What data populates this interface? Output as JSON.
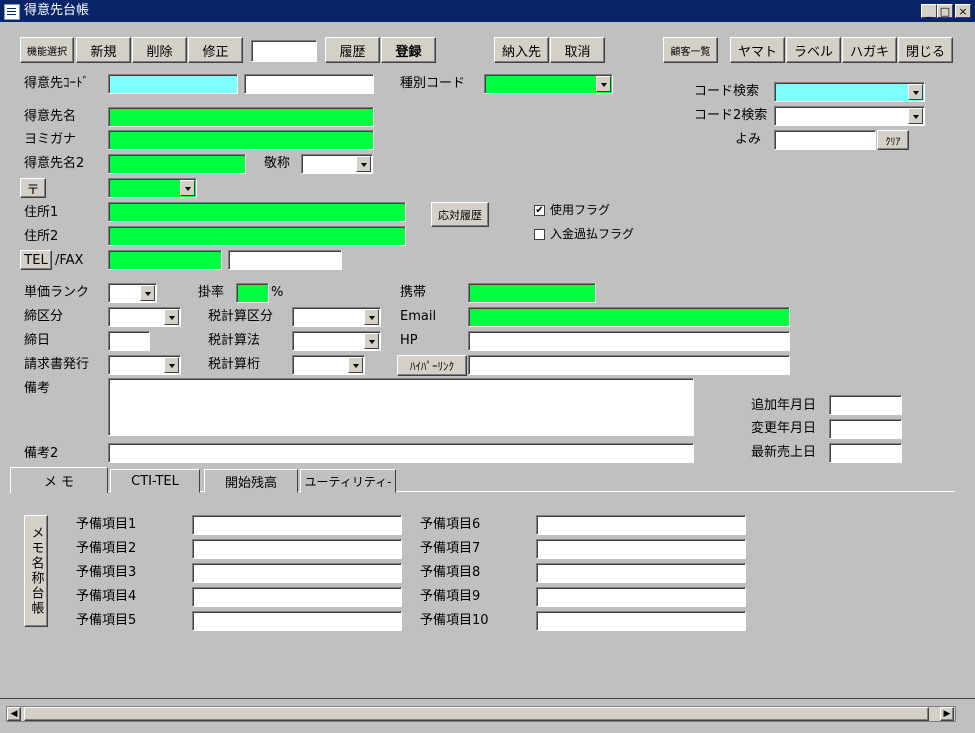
{
  "window": {
    "title": "得意先台帳",
    "min": "_",
    "max": "□",
    "close": "×"
  },
  "toolbar": {
    "func_select": "機能選択",
    "new": "新規",
    "delete": "削除",
    "edit": "修正",
    "history": "履歴",
    "register": "登録",
    "delivery": "納入先",
    "cancel": "取消",
    "customer_list": "顧客一覧",
    "yamato": "ヤマト",
    "label": "ラベル",
    "postcard": "ハガキ",
    "close": "閉じる"
  },
  "form": {
    "customer_code": "得意先ｺｰﾄﾞ",
    "type_code": "種別コード",
    "code_search": "コード検索",
    "code2_search": "コード2検索",
    "yomi": "よみ",
    "clear": "ｸﾘｱ",
    "customer_name": "得意先名",
    "kana": "ヨミガナ",
    "customer_name2": "得意先名2",
    "honorific": "敬称",
    "postal": "〒",
    "address1": "住所1",
    "address2": "住所2",
    "response_history": "応対履歴",
    "use_flag": "使用フラグ",
    "use_flag_checked": "✔",
    "overpay_flag": "入金過払フラグ",
    "tel": "TEL",
    "fax": "/FAX",
    "price_rank": "単価ランク",
    "rate": "掛率",
    "percent": "%",
    "mobile": "携帯",
    "closing_type": "締区分",
    "tax_calc_type": "税計算区分",
    "email": "Email",
    "closing_day": "締日",
    "tax_method": "税計算法",
    "hp": "HP",
    "invoice": "請求書発行",
    "tax_digits": "税計算桁",
    "hyperlink": "ﾊｲﾊﾟｰﾘﾝｸ",
    "notes": "備考",
    "notes2": "備考2",
    "added_date": "追加年月日",
    "changed_date": "変更年月日",
    "last_sale_date": "最新売上日"
  },
  "tabs": [
    "メ モ",
    "CTI-TEL",
    "開始残高",
    "ユーティリティ-"
  ],
  "memo": {
    "vertical_button": "メモ名称台帳",
    "items_left": [
      "予備項目1",
      "予備項目2",
      "予備項目3",
      "予備項目4",
      "予備項目5"
    ],
    "items_right": [
      "予備項目6",
      "予備項目7",
      "予備項目8",
      "予備項目9",
      "予備項目10"
    ]
  },
  "colors": {
    "accent_green": "#00ff40",
    "accent_cyan": "#80ffff",
    "titlebar": "#0a246a"
  }
}
